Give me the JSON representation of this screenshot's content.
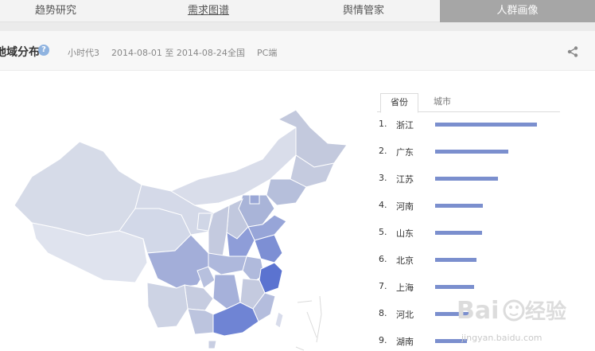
{
  "tabs": [
    {
      "label": "趋势研究"
    },
    {
      "label": "需求图谱"
    },
    {
      "label": "舆情管家"
    },
    {
      "label": "人群画像",
      "active": true
    }
  ],
  "header": {
    "title": "地域分布",
    "help": "?",
    "keyword": "小时代3",
    "date_range": "2014-08-01 至 2014-08-24",
    "region": "全国",
    "device": "PC端"
  },
  "ranking": {
    "tabs": [
      {
        "label": "省份",
        "active": true
      },
      {
        "label": "城市",
        "active": false
      }
    ],
    "bar_color": "#7b8fce",
    "items": [
      {
        "rank": "1.",
        "name": "浙江",
        "value": 1.0
      },
      {
        "rank": "2.",
        "name": "广东",
        "value": 0.72
      },
      {
        "rank": "3.",
        "name": "江苏",
        "value": 0.62
      },
      {
        "rank": "4.",
        "name": "河南",
        "value": 0.47
      },
      {
        "rank": "5.",
        "name": "山东",
        "value": 0.46
      },
      {
        "rank": "6.",
        "name": "北京",
        "value": 0.41
      },
      {
        "rank": "7.",
        "name": "上海",
        "value": 0.38
      },
      {
        "rank": "8.",
        "name": "河北",
        "value": 0.37
      },
      {
        "rank": "9.",
        "name": "湖南",
        "value": 0.31
      }
    ]
  },
  "watermark": {
    "brand": "Baidu经验",
    "url": "jingyan.baidu.com"
  }
}
